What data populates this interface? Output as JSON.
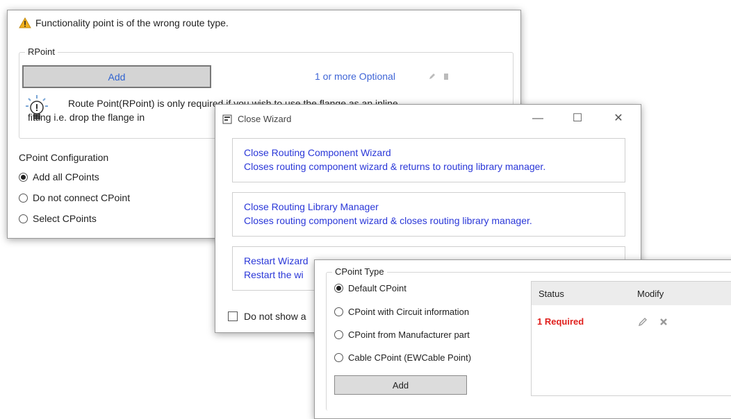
{
  "panel1": {
    "warning": "Functionality point is of the wrong route type.",
    "rpoint": {
      "group_title": "RPoint",
      "add_label": "Add",
      "status": "1 or more Optional",
      "info_line1": "Route Point(RPoint) is only required if you wish to use the flange as an inline",
      "info_line2": "fitting i.e. drop the flange in"
    },
    "cpoint_config": {
      "title": "CPoint Configuration",
      "options": [
        "Add all CPoints",
        "Do not connect CPoint",
        "Select CPoints"
      ],
      "selected": 0
    }
  },
  "close_wizard": {
    "title": "Close Wizard",
    "options": [
      {
        "title": "Close Routing Component Wizard",
        "desc": "Closes routing component wizard & returns to routing library manager."
      },
      {
        "title": "Close Routing Library Manager",
        "desc": "Closes routing component wizard & closes routing library manager."
      },
      {
        "title": "Restart Wizard",
        "desc": "Restart the wi"
      }
    ],
    "dont_show": "Do not show a"
  },
  "cpoint_type": {
    "group_title": "CPoint Type",
    "options": [
      "Default CPoint",
      "CPoint with Circuit information",
      "CPoint from Manufacturer part",
      "Cable CPoint (EWCable Point)"
    ],
    "selected": 0,
    "add_label": "Add",
    "table": {
      "headers": [
        "Status",
        "Modify"
      ],
      "rows": [
        {
          "status": "1 Required"
        }
      ]
    }
  },
  "colors": {
    "link": "#2a37d8",
    "required": "#e0201d",
    "optional": "#3f65d6",
    "warning": "#f2b01e"
  }
}
